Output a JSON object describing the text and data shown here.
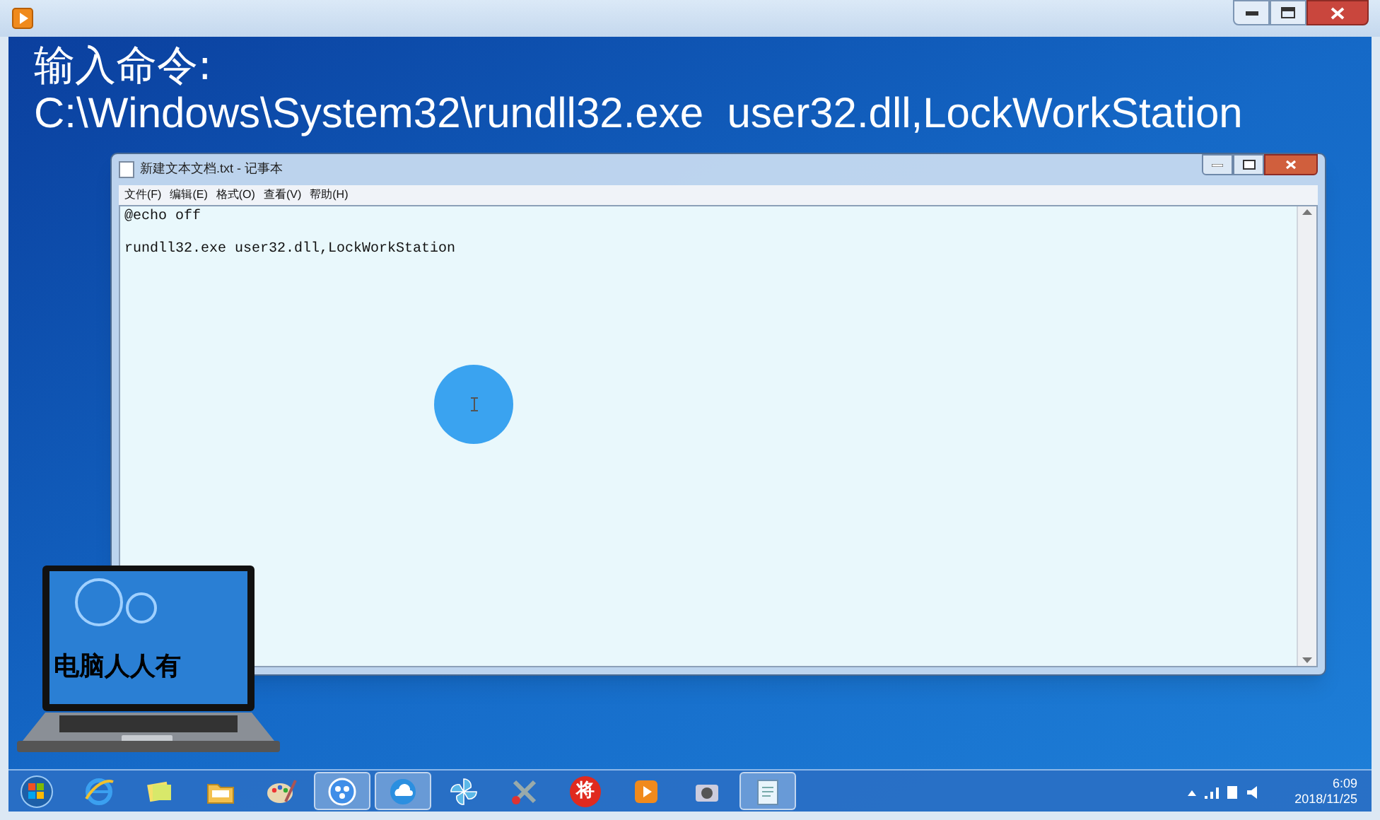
{
  "heading": {
    "line_1": "输入命令:",
    "line_2": "C:\\Windows\\System32\\rundll32.exe  user32.dll,LockWorkStation"
  },
  "notepad": {
    "title": "新建文本文档.txt - 记事本",
    "menu": [
      "文件(F)",
      "编辑(E)",
      "格式(O)",
      "查看(V)",
      "帮助(H)"
    ],
    "lines": [
      "@echo off",
      "rundll32.exe user32.dll,LockWorkStation"
    ]
  },
  "logo": {
    "text": "电脑人人有"
  },
  "taskbar": {
    "apps": [
      {
        "kind": "browser",
        "selected": false
      },
      {
        "kind": "notes",
        "selected": false
      },
      {
        "kind": "folder",
        "selected": false
      },
      {
        "kind": "palette",
        "selected": false
      },
      {
        "kind": "dots",
        "selected": true
      },
      {
        "kind": "cloud",
        "selected": true
      },
      {
        "kind": "pinwheel",
        "selected": false
      },
      {
        "kind": "tools",
        "selected": false
      },
      {
        "kind": "glyph",
        "label": "将",
        "selected": false
      },
      {
        "kind": "play",
        "selected": false
      },
      {
        "kind": "camera",
        "selected": false
      },
      {
        "kind": "notepad",
        "selected": true
      }
    ],
    "clock": {
      "time": "6:09",
      "date": "2018/11/25"
    }
  }
}
